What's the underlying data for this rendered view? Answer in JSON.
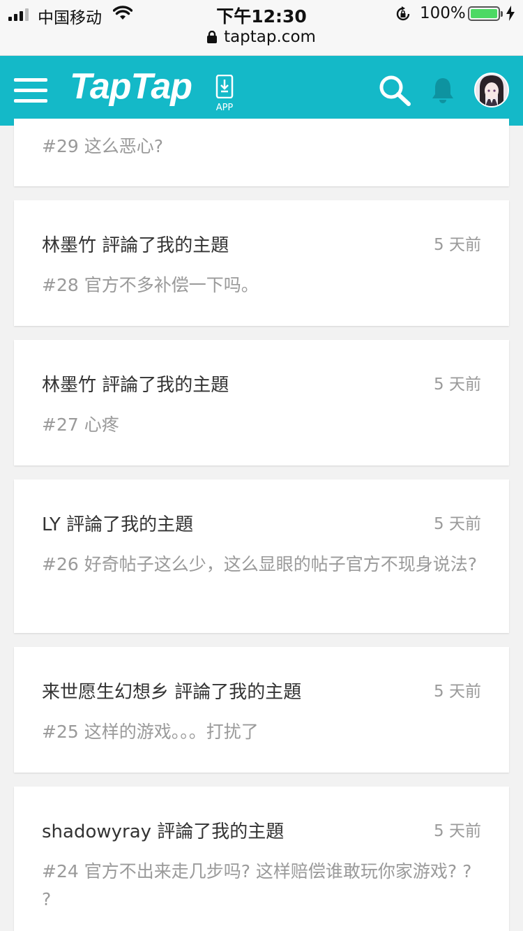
{
  "status_bar": {
    "carrier": "中国移动",
    "time": "下午12:30",
    "battery_percent": "100%",
    "url": "taptap.com"
  },
  "header": {
    "logo": "TapTap",
    "app_label": "APP",
    "accent_color": "#14b9c8"
  },
  "notifications": [
    {
      "title": "",
      "time": "",
      "body": "#29 这么恶心?"
    },
    {
      "title": "林墨竹 評論了我的主題",
      "time": "5 天前",
      "body": "#28 官方不多补偿一下吗。"
    },
    {
      "title": "林墨竹 評論了我的主題",
      "time": "5 天前",
      "body": "#27 心疼"
    },
    {
      "title": "LY 評論了我的主題",
      "time": "5 天前",
      "body": "#26 好奇帖子这么少，这么显眼的帖子官方不现身说法?"
    },
    {
      "title": "来世愿生幻想乡 評論了我的主題",
      "time": "5 天前",
      "body": "#25 这样的游戏。。。打扰了"
    },
    {
      "title": "shadowyray 評論了我的主題",
      "time": "5 天前",
      "body": "#24 官方不出来走几步吗? 这样赔偿谁敢玩你家游戏? ? ?"
    }
  ]
}
